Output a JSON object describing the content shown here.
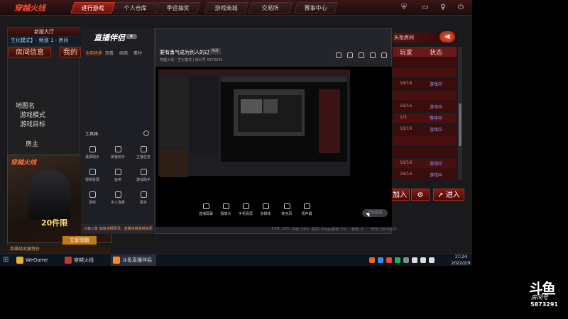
{
  "game": {
    "logo": "穿越火线",
    "nav": [
      "进行游戏",
      "个人仓库",
      "季运抽奖",
      "游戏商城",
      "交易所",
      "赛事中心"
    ],
    "left_header": "新版大厅",
    "channel": "生化模式】- 频道 1 - 房间",
    "tabs": [
      "房间信息",
      "我的"
    ],
    "info_labels": [
      "地图名",
      "游戏模式",
      "游戏目标",
      "房主"
    ],
    "ad_title": "穿越火线",
    "ad_text": "20件限",
    "ad_button": "立即领取",
    "footer": "英雄级武器特价",
    "right_header": "头衔房间",
    "right_cols": [
      "玩家",
      "状态"
    ],
    "right_rows": [
      {
        "a": "",
        "b": ""
      },
      {
        "a": "",
        "b": ""
      },
      {
        "a": "16/16",
        "b": "游戏中"
      },
      {
        "a": "",
        "b": ""
      },
      {
        "a": "16/16",
        "b": "游戏中"
      },
      {
        "a": "1/3",
        "b": "等待中"
      },
      {
        "a": "16/16",
        "b": "游戏中"
      },
      {
        "a": "",
        "b": ""
      },
      {
        "a": "",
        "b": ""
      },
      {
        "a": "16/16",
        "b": "游戏中"
      },
      {
        "a": "16/16",
        "b": "游戏中"
      }
    ],
    "join_label": "加入",
    "enter_label": "进入",
    "accent": "#a3251b"
  },
  "taskbar": {
    "items": [
      "WeGame",
      "穿越火线",
      "斗鱼直播伴侣"
    ],
    "time": "17:24",
    "date": "2022/2/9"
  },
  "stream_app": {
    "title": "直播伴侣",
    "tabs": [
      "全部场景",
      "观看",
      "画面",
      "素材"
    ],
    "tools_header": "工具箱",
    "tools": [
      "录屏助手",
      "房管助手",
      "主播任务",
      "视频投屏",
      "鱼吧",
      "游戏助手",
      "游戏",
      "多人连麦",
      "更多"
    ],
    "warning": "斗鱼公告 如有违规情况，直播将被强制关闭"
  },
  "stream": {
    "title": "要有勇气成为别人的过去",
    "tag": "修改",
    "sub": "穿越火线 - 生化模式 | 房间号 5873291",
    "controls": [
      "直播屏幕",
      "摄像头",
      "手机投屏",
      "多媒体",
      "麦克风",
      "扬声器"
    ],
    "start": "开始直播",
    "stats": [
      "CPU: 22%",
      "内存: 35%",
      "码率: 0kbps",
      "丢帧: 0%",
      "帧率: 0",
      "时长: 00:00:00"
    ]
  },
  "watermark": {
    "brand": "斗鱼",
    "room_label": "房间号",
    "room_number": "5873291"
  }
}
